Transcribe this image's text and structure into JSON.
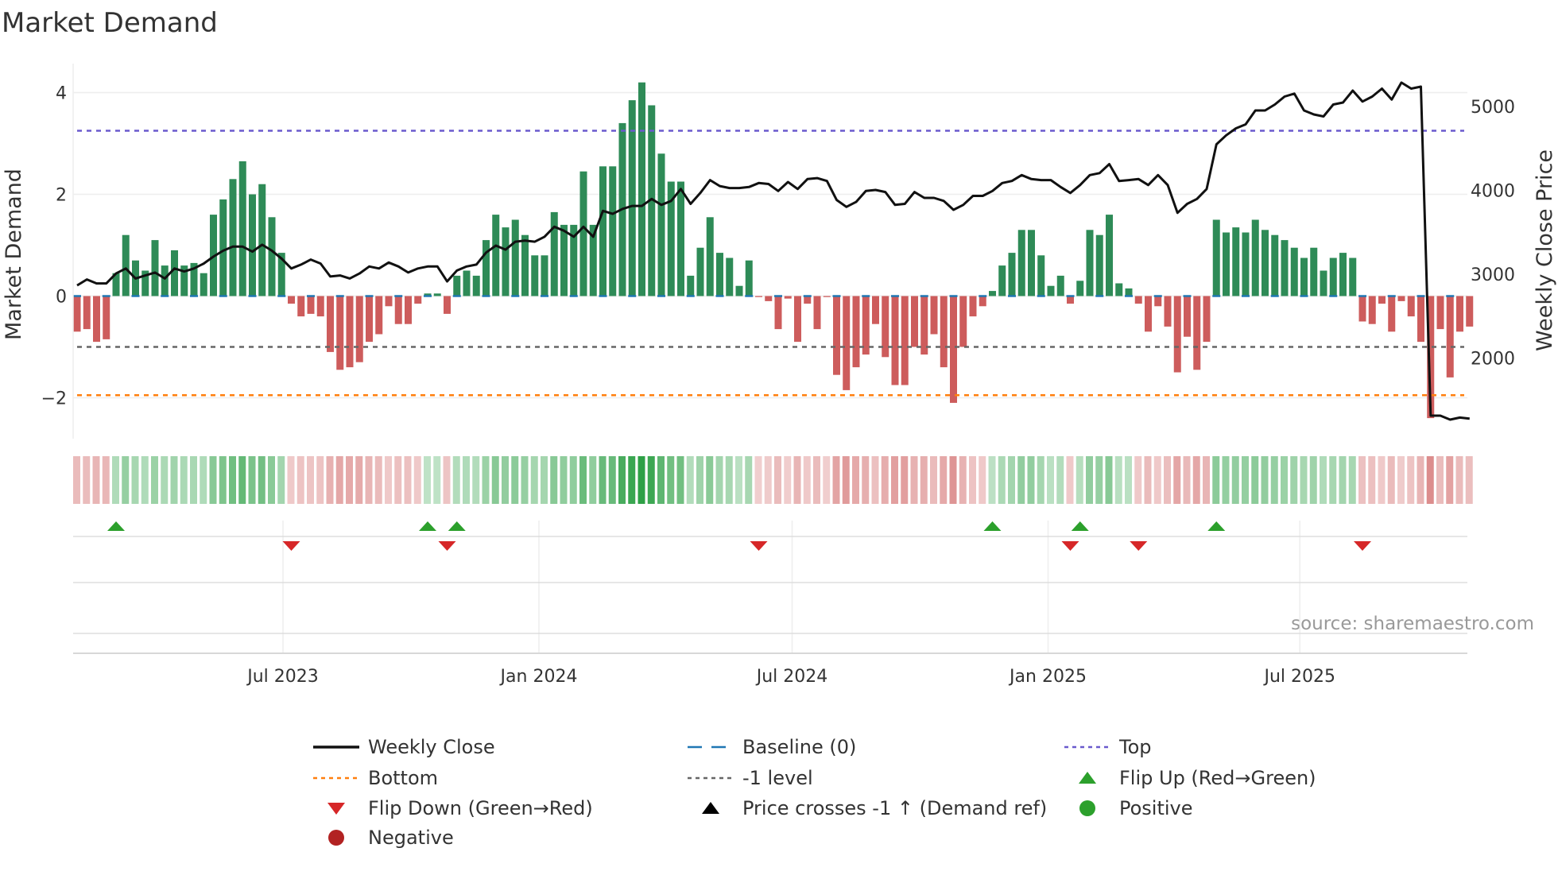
{
  "chart_data": {
    "type": "bar",
    "title": "Market Demand",
    "ylabel": "Market Demand",
    "y2label": "Weekly Close Price",
    "ylim": [
      -2.8,
      4.5
    ],
    "y2lim": [
      1100,
      5400
    ],
    "yticks": [
      -2,
      0,
      2,
      4
    ],
    "ytick_labels": [
      "−2",
      "0",
      "2",
      "4"
    ],
    "y2ticks": [
      2000,
      3000,
      4000,
      5000
    ],
    "y2tick_labels": [
      "2000",
      "3000",
      "4000",
      "5000"
    ],
    "start_date": "2023-02-03",
    "frequency": "weekly",
    "xticks": [
      {
        "date": "2023-07-01",
        "label": "Jul 2023"
      },
      {
        "date": "2024-01-01",
        "label": "Jan 2024"
      },
      {
        "date": "2024-07-01",
        "label": "Jul 2024"
      },
      {
        "date": "2025-01-01",
        "label": "Jan 2025"
      },
      {
        "date": "2025-07-01",
        "label": "Jul 2025"
      }
    ],
    "levels": {
      "baseline": 0,
      "top": 3.25,
      "minus_one": -1,
      "bottom": -1.95
    },
    "demand": [
      -0.7,
      -0.65,
      -0.9,
      -0.85,
      0.45,
      1.2,
      0.7,
      0.5,
      1.1,
      0.6,
      0.9,
      0.6,
      0.65,
      0.45,
      1.6,
      1.9,
      2.3,
      2.65,
      2.0,
      2.2,
      1.55,
      0.85,
      -0.15,
      -0.4,
      -0.35,
      -0.4,
      -1.1,
      -1.45,
      -1.4,
      -1.3,
      -0.9,
      -0.75,
      -0.2,
      -0.55,
      -0.55,
      -0.15,
      0.05,
      0.05,
      -0.35,
      0.4,
      0.5,
      0.4,
      1.1,
      1.6,
      1.35,
      1.5,
      1.2,
      0.8,
      0.8,
      1.65,
      1.4,
      1.4,
      2.45,
      1.4,
      2.55,
      2.55,
      3.4,
      3.85,
      4.2,
      3.75,
      2.8,
      2.25,
      2.25,
      0.4,
      0.95,
      1.55,
      0.85,
      0.75,
      0.2,
      0.7,
      -0.02,
      -0.1,
      -0.65,
      -0.05,
      -0.9,
      -0.15,
      -0.65,
      -0.02,
      -1.55,
      -1.85,
      -1.4,
      -1.15,
      -0.55,
      -1.2,
      -1.75,
      -1.75,
      -1.0,
      -1.15,
      -0.75,
      -1.4,
      -2.1,
      -1.0,
      -0.4,
      -0.2,
      0.1,
      0.6,
      0.85,
      1.3,
      1.3,
      0.8,
      0.2,
      0.4,
      -0.15,
      0.3,
      1.3,
      1.2,
      1.6,
      0.25,
      0.15,
      -0.15,
      -0.7,
      -0.2,
      -0.6,
      -1.5,
      -0.8,
      -1.45,
      -0.9,
      1.5,
      1.25,
      1.35,
      1.25,
      1.5,
      1.3,
      1.2,
      1.1,
      0.95,
      0.75,
      0.95,
      0.5,
      0.75,
      0.85,
      0.75,
      -0.5,
      -0.55,
      -0.15,
      -0.7,
      -0.1,
      -0.4,
      -0.9,
      -2.4,
      -0.65,
      -1.6,
      -0.7,
      -0.6
    ],
    "close": [
      2865,
      2936,
      2889,
      2889,
      3008,
      3067,
      2948,
      2984,
      3019,
      2948,
      3067,
      3031,
      3067,
      3126,
      3209,
      3280,
      3328,
      3328,
      3268,
      3351,
      3280,
      3185,
      3067,
      3114,
      3174,
      3126,
      2972,
      2984,
      2948,
      3008,
      3091,
      3067,
      3138,
      3091,
      3019,
      3067,
      3091,
      3091,
      2913,
      3043,
      3091,
      3114,
      3257,
      3340,
      3292,
      3387,
      3399,
      3387,
      3446,
      3565,
      3518,
      3446,
      3565,
      3446,
      3755,
      3719,
      3778,
      3814,
      3814,
      3897,
      3826,
      3873,
      4016,
      3838,
      3968,
      4122,
      4051,
      4027,
      4027,
      4039,
      4087,
      4075,
      3992,
      4099,
      4016,
      4134,
      4146,
      4111,
      3885,
      3802,
      3861,
      3992,
      4004,
      3980,
      3826,
      3838,
      3980,
      3909,
      3909,
      3873,
      3767,
      3826,
      3933,
      3933,
      3992,
      4087,
      4111,
      4182,
      4134,
      4122,
      4122,
      4039,
      3968,
      4063,
      4182,
      4205,
      4312,
      4111,
      4122,
      4134,
      4063,
      4182,
      4063,
      3731,
      3838,
      3897,
      4016,
      4549,
      4656,
      4739,
      4787,
      4953,
      4953,
      5024,
      5119,
      5154,
      4953,
      4905,
      4881,
      5024,
      5047,
      5190,
      5059,
      5119,
      5213,
      5083,
      5285,
      5213,
      5237,
      1311,
      1311,
      1264,
      1288,
      1276
    ],
    "flip_up_weeks": [
      4,
      36,
      39,
      94,
      103,
      117
    ],
    "flip_down_weeks": [
      22,
      38,
      70,
      102,
      109,
      132
    ],
    "legend": [
      {
        "label": "Weekly Close",
        "kind": "line",
        "color": "#111111"
      },
      {
        "label": "Baseline (0)",
        "kind": "dash",
        "color": "#1f77b4"
      },
      {
        "label": "Top",
        "kind": "dot",
        "color": "#6a5acd"
      },
      {
        "label": "Bottom",
        "kind": "dot",
        "color": "#ff7f0e"
      },
      {
        "label": "-1 level",
        "kind": "dot",
        "color": "#666666"
      },
      {
        "label": "Flip Up (Red→Green)",
        "kind": "tri-up",
        "color": "#2ca02c"
      },
      {
        "label": "Flip Down (Green→Red)",
        "kind": "tri-down",
        "color": "#d62728"
      },
      {
        "label": "Price crosses -1 ↑ (Demand ref)",
        "kind": "tri-up",
        "color": "#000000"
      },
      {
        "label": "Positive",
        "kind": "circle",
        "color": "#2ca02c"
      },
      {
        "label": "Negative",
        "kind": "circle",
        "color": "#b22222"
      }
    ],
    "legend_placement": "bottom",
    "source": "source: sharemaestro.com",
    "colors": {
      "positive": "#2e8b57",
      "negative": "#cd5c5c",
      "price": "#111111"
    }
  }
}
